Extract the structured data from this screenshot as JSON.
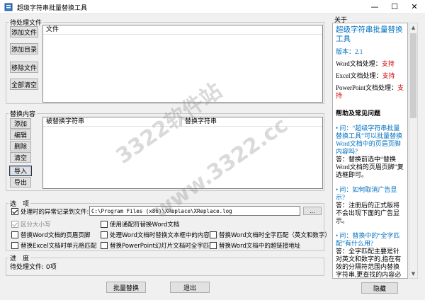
{
  "window": {
    "title": "超级字符串批量替换工具",
    "minimize": "—",
    "maximize": "☐",
    "close": "✕"
  },
  "files_group": {
    "label": "待处理文件",
    "add_file": "添加文件",
    "add_dir": "添加目录",
    "remove_file": "移除文件",
    "clear_all": "全部清空",
    "column": "文件"
  },
  "replace_group": {
    "label": "替换内容",
    "add": "添加",
    "edit": "编辑",
    "delete": "删除",
    "clear": "清空",
    "import": "导入",
    "export": "导出",
    "col_find": "被替换字符串",
    "col_replace": "替换字符串"
  },
  "options_group": {
    "label": "选　项",
    "save_log": "处理时的异常记录到文件:",
    "log_path": "C:\\Program Files (x86)\\XReplace\\XReplace.log",
    "browse": "...",
    "case_sensitive": "区分大小写",
    "use_wildcard": "使用通配符替换Word文档",
    "word_header_footer": "替换Word文档的页眉页脚",
    "word_textbox": "处理Word文档时替换文本框中的内容",
    "word_full_width": "替换Word文档时全字匹配（英文和数字）",
    "excel_cell": "替换Excel文档时单元格匹配",
    "ppt_full_word": "替换PowerPoint幻灯片文档时全字匹配",
    "word_hyperlink": "替换Word文档中的超链接地址"
  },
  "progress_group": {
    "label": "进　度",
    "status": "待处理文件: 0项"
  },
  "bottom": {
    "batch_replace": "批量替换",
    "exit": "退出",
    "hide": "隐藏"
  },
  "about": {
    "label": "关于",
    "title": "超级字符串批量替换工具",
    "version_label": "版本：",
    "version": "2.1",
    "word_label": "Word文档处理：",
    "word_val": "支持",
    "excel_label": "Excel文档处理：",
    "excel_val": "支持",
    "ppt_label": "PowerPoint文档处理：",
    "ppt_val": "支持",
    "faq_heading": "帮助及常见问题",
    "q1": "问：“超级字符串批量替换工具”可以批量替换Word文档中的页眉页脚内容吗?",
    "a1": "答：替换前选中“替换Word文档的页眉页脚”复选框即可。",
    "q2": "问：如何取消广告显示?",
    "a2": "答：注册后的正式版将不会出现下面的广告显示。",
    "q3": "问：替换中的“全字匹配”有什么用?",
    "a3": "答：全字匹配主要是针对英文和数字的,指在有效的分隔符范围内替换字符串,更查找的内容必须与分隔符之间的部分完全一致,必须全部都可以,比"
  },
  "watermark": {
    "line1": "3322软件站",
    "line2": "www.3322.cc"
  }
}
